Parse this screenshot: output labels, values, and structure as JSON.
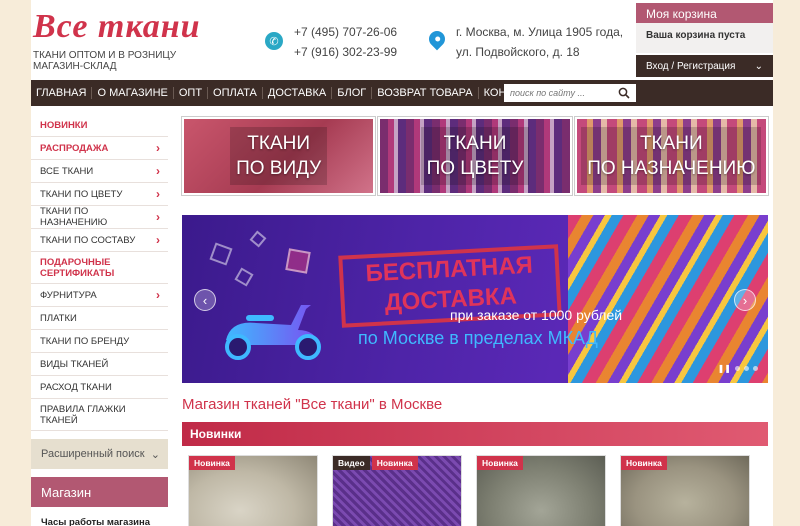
{
  "header": {
    "logo": "Все ткани",
    "tagline_line1": "ТКАНИ ОПТОМ И В РОЗНИЦУ",
    "tagline_line2": "МАГАЗИН-СКЛАД",
    "phone1": "+7 (495) 707-26-06",
    "phone2": "+7 (916) 302-23-99",
    "address_line1": "г. Москва, м. Улица 1905 года,",
    "address_line2": "ул. Подвойского, д. 18"
  },
  "cart": {
    "title": "Моя корзина",
    "empty": "Ваша корзина пуста",
    "login": "Вход / Регистрация"
  },
  "nav": {
    "items": [
      "ГЛАВНАЯ",
      "О МАГАЗИНЕ",
      "ОПТ",
      "ОПЛАТА",
      "ДОСТАВКА",
      "БЛОГ",
      "ВОЗВРАТ ТОВАРА",
      "КОНТАКТЫ"
    ],
    "search_placeholder": "поиск по сайту ..."
  },
  "sidebar": {
    "items": [
      {
        "label": "НОВИНКИ"
      },
      {
        "label": "РАСПРОДАЖА"
      },
      {
        "label": "ВСЕ ТКАНИ"
      },
      {
        "label": "ТКАНИ ПО ЦВЕТУ"
      },
      {
        "label": "ТКАНИ ПО НАЗНАЧЕНИЮ"
      },
      {
        "label": "ТКАНИ ПО СОСТАВУ"
      },
      {
        "label": "ПОДАРОЧНЫЕ СЕРТИФИКАТЫ"
      },
      {
        "label": "ФУРНИТУРА"
      },
      {
        "label": "ПЛАТКИ"
      },
      {
        "label": "ТКАНИ ПО БРЕНДУ"
      },
      {
        "label": "ВИДЫ ТКАНЕЙ"
      },
      {
        "label": "РАСХОД ТКАНИ"
      },
      {
        "label": "ПРАВИЛА ГЛАЖКИ ТКАНЕЙ"
      }
    ],
    "advanced_search": "Расширенный поиск",
    "shop_heading": "Магазин",
    "shop_hours": "Часы работы магазина \"Все"
  },
  "tiles": [
    {
      "line1": "ТКАНИ",
      "line2": "ПО ВИДУ"
    },
    {
      "line1": "ТКАНИ",
      "line2": "ПО ЦВЕТУ"
    },
    {
      "line1": "ТКАНИ",
      "line2": "ПО НАЗНАЧЕНИЮ"
    }
  ],
  "banner": {
    "title_line1": "БЕСПЛАТНАЯ",
    "title_line2": "ДОСТАВКА",
    "sub1": "при заказе от 1000 рублей",
    "sub2": "по Москве в пределах МКАД",
    "prev": "‹",
    "next": "›"
  },
  "main": {
    "heading": "Магазин тканей \"Все ткани\" в Москве",
    "section_title": "Новинки"
  },
  "products": [
    {
      "badges": [
        "Новинка"
      ]
    },
    {
      "badges": [
        "Видео",
        "Новинка"
      ]
    },
    {
      "badges": [
        "Новинка"
      ]
    },
    {
      "badges": [
        "Новинка"
      ]
    }
  ],
  "colors": {
    "brand_red": "#d0334b",
    "nav_dark": "#3b2b26",
    "cart_pink": "#b25872",
    "background": "#f7ecd9"
  }
}
